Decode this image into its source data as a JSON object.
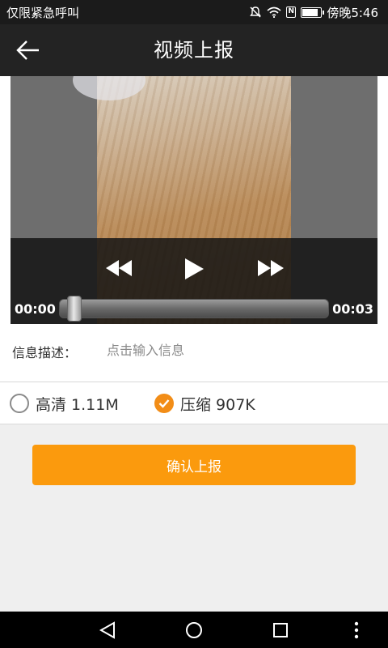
{
  "status_bar": {
    "left_text": "仅限紧急呼叫",
    "time": "傍晚5:46",
    "nfc_glyph": "N",
    "battery_level": 0.9,
    "icons": [
      "mute-icon",
      "wifi-icon",
      "nfc-icon",
      "battery-icon"
    ]
  },
  "header": {
    "title": "视频上报",
    "back_icon": "arrow-left-icon"
  },
  "player": {
    "current_time": "00:00",
    "total_time": "00:03",
    "progress": 0.0,
    "icons": [
      "rewind-icon",
      "play-icon",
      "fast-forward-icon"
    ]
  },
  "info": {
    "label": "信息描述：",
    "placeholder": "点击输入信息",
    "value": ""
  },
  "quality": {
    "options": [
      {
        "label": "高清 1.11M",
        "checked": false
      },
      {
        "label": "压缩 907K",
        "checked": true
      }
    ],
    "accent_color": "#f28d17"
  },
  "actions": {
    "submit_label": "确认上报",
    "submit_color": "#fb9a0d"
  },
  "nav_bar": {
    "icons": [
      "nav-back-icon",
      "nav-home-icon",
      "nav-recent-icon",
      "nav-menu-icon"
    ]
  }
}
